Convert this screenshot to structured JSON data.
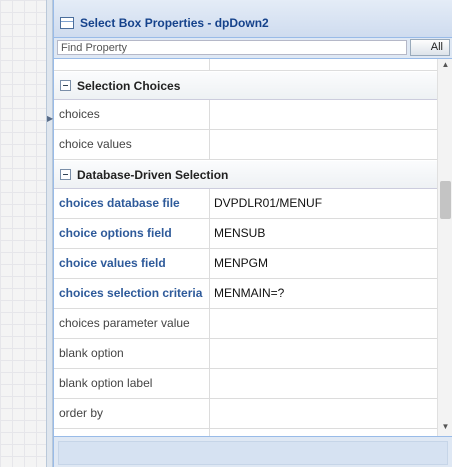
{
  "panel": {
    "title": "Select Box Properties - dpDown2",
    "title_icon": "panel-window-icon"
  },
  "search": {
    "placeholder": "Find Property",
    "value": "",
    "all_button_label": "All"
  },
  "groups": [
    {
      "label": "Selection Choices",
      "expanded": true,
      "rows": [
        {
          "name": "choices",
          "value": "",
          "bold": false
        },
        {
          "name": "choice values",
          "value": "",
          "bold": false
        }
      ]
    },
    {
      "label": "Database-Driven Selection",
      "expanded": true,
      "rows": [
        {
          "name": "choices database file",
          "value": "DVPDLR01/MENUF",
          "bold": true
        },
        {
          "name": "choice options field",
          "value": "MENSUB",
          "bold": true
        },
        {
          "name": "choice values field",
          "value": "MENPGM",
          "bold": true
        },
        {
          "name": "choices selection criteria",
          "value": "MENMAIN=?",
          "bold": true
        },
        {
          "name": "choices parameter value",
          "value": "",
          "bold": false
        },
        {
          "name": "blank option",
          "value": "",
          "bold": false
        },
        {
          "name": "blank option label",
          "value": "",
          "bold": false
        },
        {
          "name": "order by",
          "value": "",
          "bold": false
        }
      ]
    }
  ],
  "icons": {
    "collapse": "collapse-minus-icon",
    "scroll_up": "scroll-up-arrow-icon",
    "scroll_down": "scroll-down-arrow-icon",
    "splitter": "splitter-collapse-arrow-icon"
  },
  "colors": {
    "title_text": "#15428b",
    "panel_background": "#dfe8f4",
    "border": "#99bbe8",
    "modified_property_text": "#2e5a9a"
  }
}
